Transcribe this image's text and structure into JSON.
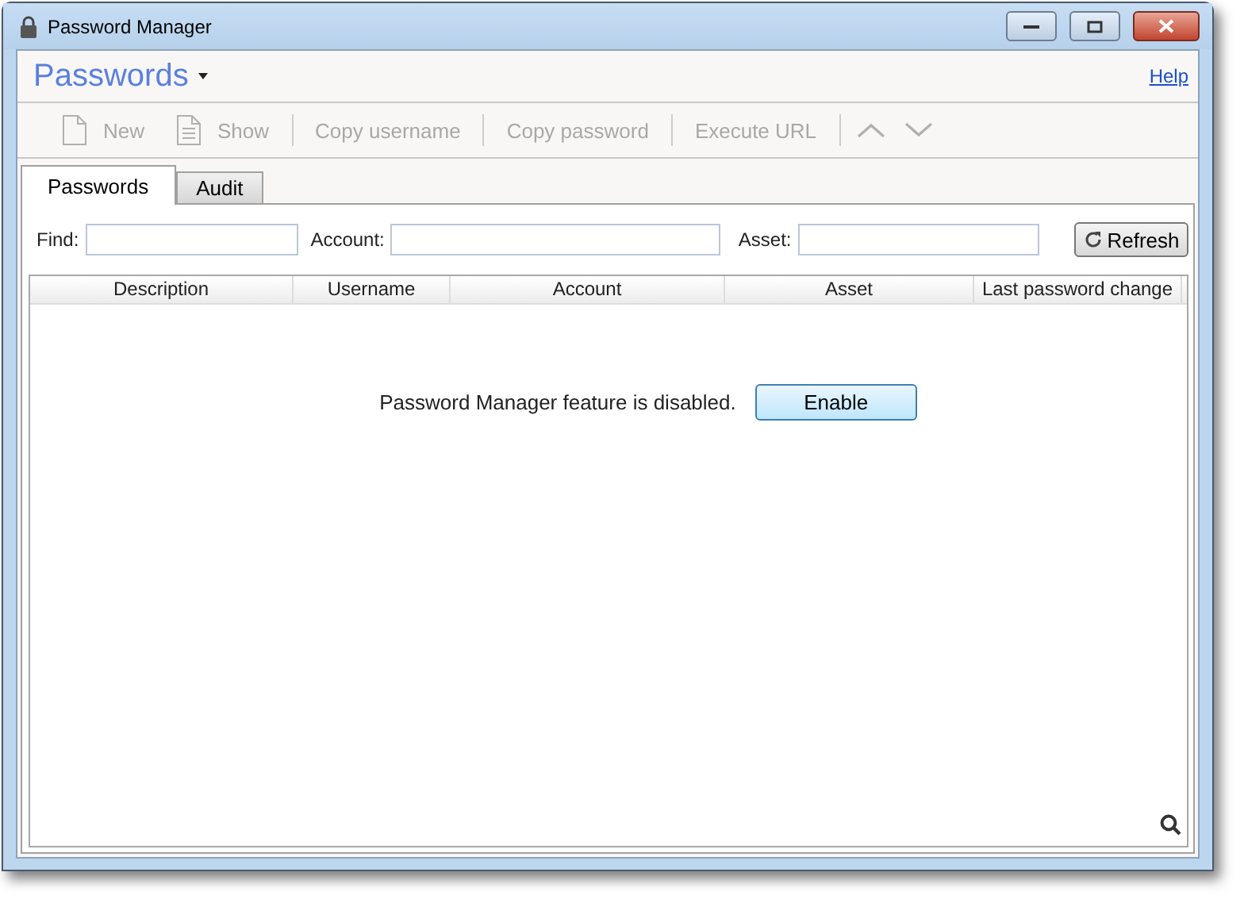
{
  "window": {
    "title": "Password Manager"
  },
  "header": {
    "title": "Passwords",
    "help": "Help"
  },
  "toolbar": [
    {
      "kind": "new",
      "label": "New",
      "disabled": true
    },
    {
      "kind": "show",
      "label": "Show",
      "disabled": true
    },
    {
      "kind": "separator"
    },
    {
      "kind": "text",
      "label": "Copy username",
      "disabled": true
    },
    {
      "kind": "separator"
    },
    {
      "kind": "text",
      "label": "Copy password",
      "disabled": true
    },
    {
      "kind": "separator"
    },
    {
      "kind": "text",
      "label": "Execute URL",
      "disabled": true
    },
    {
      "kind": "separator"
    },
    {
      "kind": "up",
      "disabled": true
    },
    {
      "kind": "down",
      "disabled": true
    }
  ],
  "tabs": [
    {
      "label": "Passwords",
      "selected": true
    },
    {
      "label": "Audit",
      "selected": false
    }
  ],
  "filters": [
    {
      "label": "Find:"
    },
    {
      "label": "Account:"
    },
    {
      "label": "Asset:"
    }
  ],
  "refresh": "Refresh",
  "table": {
    "columns": [
      "Description",
      "Username",
      "Account",
      "Asset",
      "Last password change"
    ]
  },
  "message": "Password Manager feature is disabled.",
  "enable": "Enable"
}
